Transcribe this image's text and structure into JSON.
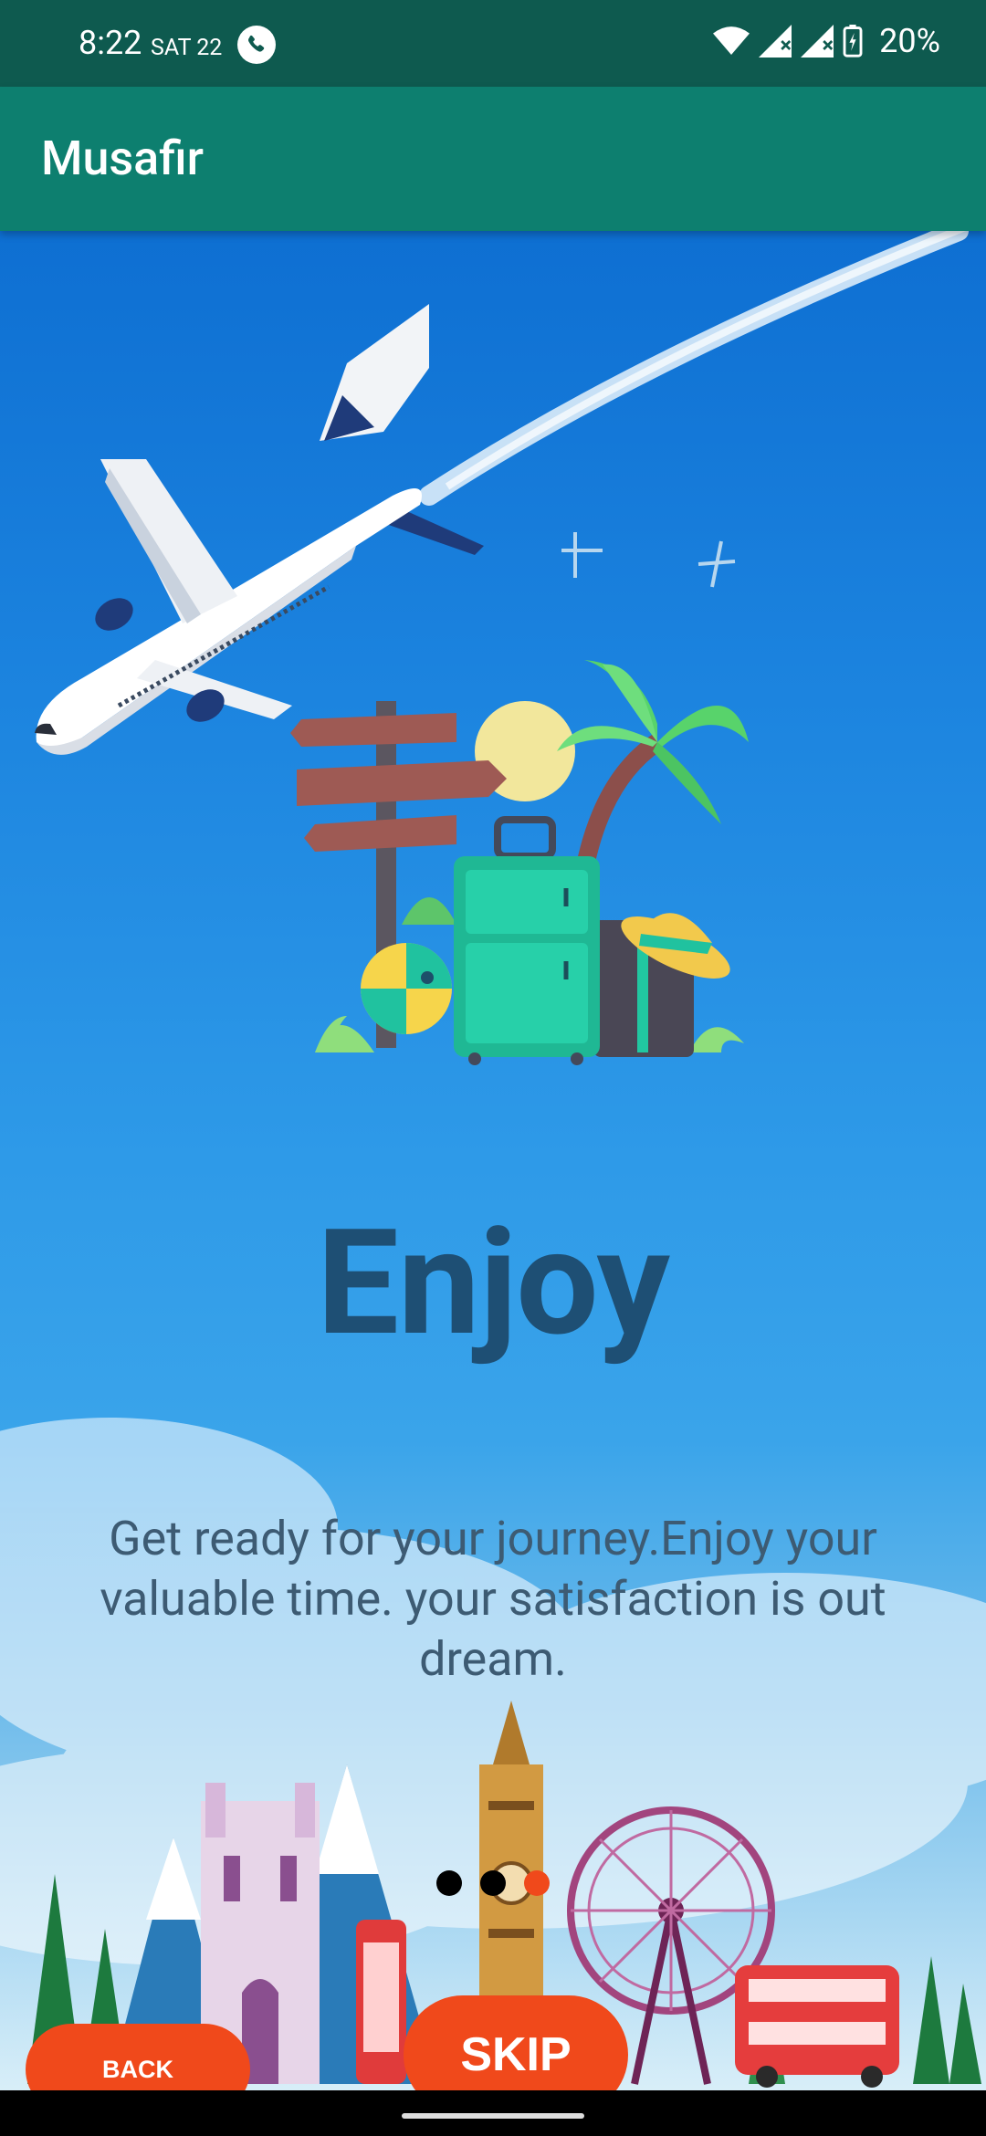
{
  "status_bar": {
    "time": "8:22",
    "day": "SAT 22",
    "battery_percent": "20%",
    "icons": [
      "phone-call-icon",
      "wifi-icon",
      "signal-icon",
      "signal-icon",
      "battery-charging-icon"
    ]
  },
  "app_bar": {
    "title": "Musafir"
  },
  "onboarding": {
    "heading": "Enjoy",
    "description": "Get ready for your journey.Enjoy your valuable time. your satisfaction is out dream.",
    "page_indicator": {
      "total": 3,
      "current": 3
    }
  },
  "buttons": {
    "back": "BACK",
    "skip": "SKIP"
  },
  "colors": {
    "status_bar": "#0e5a4f",
    "app_bar": "#0d7f6f",
    "accent": "#f0491b",
    "heading": "#1e4f74"
  }
}
